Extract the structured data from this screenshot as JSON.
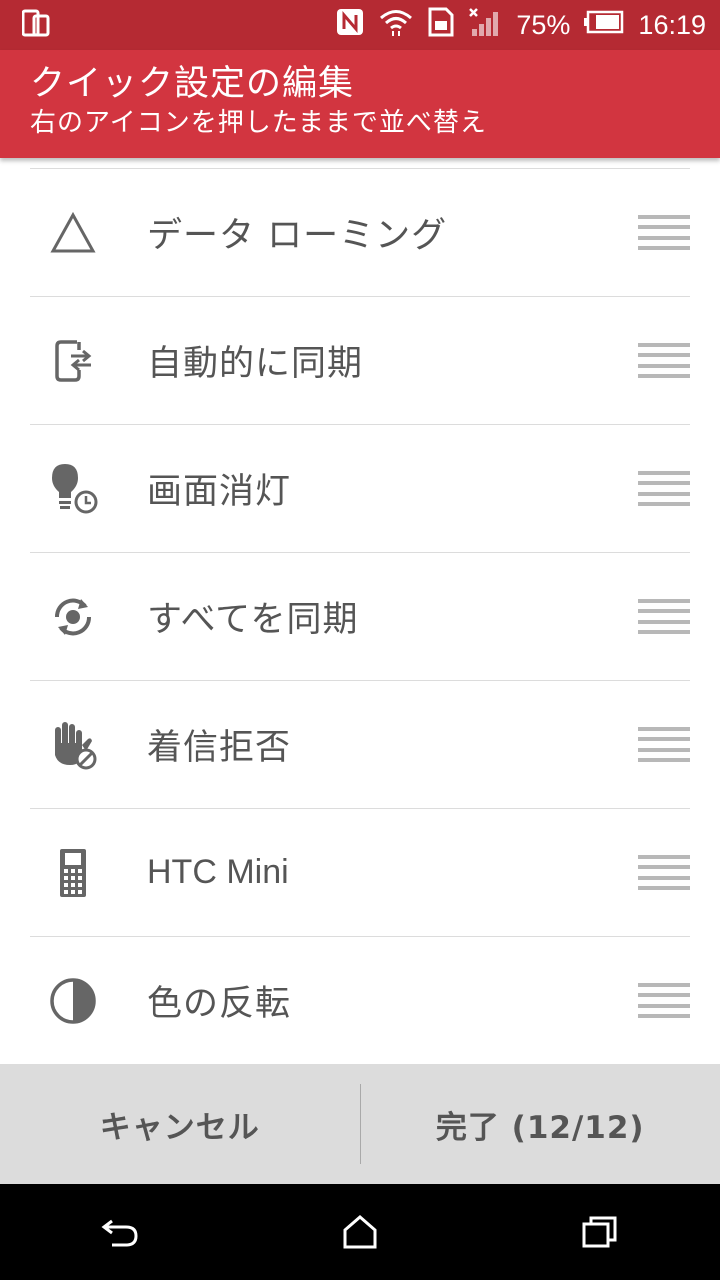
{
  "status_bar": {
    "battery_percent": "75%",
    "time": "16:19",
    "icons": [
      "device-icon",
      "nfc-icon",
      "wifi-icon",
      "sd-card-icon",
      "signal-icon",
      "battery-icon"
    ]
  },
  "header": {
    "title": "クイック設定の編集",
    "subtitle": "右のアイコンを押したままで並べ替え"
  },
  "items": [
    {
      "label": "データ ローミング",
      "icon": "triangle-icon"
    },
    {
      "label": "自動的に同期",
      "icon": "phone-sync-icon"
    },
    {
      "label": "画面消灯",
      "icon": "bulb-timer-icon"
    },
    {
      "label": "すべてを同期",
      "icon": "sync-icon"
    },
    {
      "label": "着信拒否",
      "icon": "hand-block-icon"
    },
    {
      "label": "HTC Mini",
      "icon": "htc-mini-icon"
    },
    {
      "label": "色の反転",
      "icon": "invert-color-icon"
    }
  ],
  "footer": {
    "cancel_label": "キャンセル",
    "done_label": "完了 (12/12)"
  },
  "colors": {
    "status_bar": "#b52a33",
    "header": "#d23540",
    "footer": "#dcdcdc",
    "icon": "#666666"
  }
}
